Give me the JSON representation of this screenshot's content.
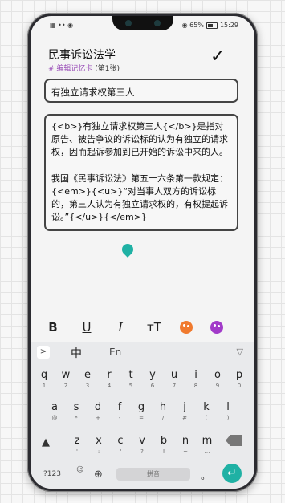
{
  "status": {
    "left": "▦ •• ◉",
    "battery_text": "◉ 65%",
    "time": "15:29"
  },
  "header": {
    "title": "民事诉讼法学",
    "subtitle_edit": "# 编辑记忆卡",
    "subtitle_count": " (第1张)",
    "confirm_glyph": "✓"
  },
  "card": {
    "front": "有独立请求权第三人",
    "back_para1": "{<b>}有独立请求权第三人{</b>}是指对原告、被告争议的诉讼标的认为有独立的请求权，因而起诉参加到已开始的诉讼中来的人。",
    "back_para2": "我国《民事诉讼法》第五十六条第一款规定：{<em>}{<u>}“对当事人双方的诉讼标的，第三人认为有独立请求权的，有权提起诉讼。”{</u>}{</em>}"
  },
  "format_bar": {
    "bold": "B",
    "underline": "U",
    "italic": "I",
    "text_size": "тT",
    "palette1_color": "#f07a2e",
    "palette2_color": "#a23bc9"
  },
  "keyboard": {
    "toolbar_arrow": ">",
    "mode_chinese": "中",
    "mode_english": "En",
    "collapse": "▽",
    "row1": [
      {
        "k": "q",
        "s": "1"
      },
      {
        "k": "w",
        "s": "2"
      },
      {
        "k": "e",
        "s": "3"
      },
      {
        "k": "r",
        "s": "4"
      },
      {
        "k": "t",
        "s": "5"
      },
      {
        "k": "y",
        "s": "6"
      },
      {
        "k": "u",
        "s": "7"
      },
      {
        "k": "i",
        "s": "8"
      },
      {
        "k": "o",
        "s": "9"
      },
      {
        "k": "p",
        "s": "0"
      }
    ],
    "row2": [
      {
        "k": "a",
        "s": "@"
      },
      {
        "k": "s",
        "s": "*"
      },
      {
        "k": "d",
        "s": "+"
      },
      {
        "k": "f",
        "s": "-"
      },
      {
        "k": "g",
        "s": "="
      },
      {
        "k": "h",
        "s": "/"
      },
      {
        "k": "j",
        "s": "#"
      },
      {
        "k": "k",
        "s": "("
      },
      {
        "k": "l",
        "s": ")"
      }
    ],
    "row3": [
      {
        "k": "z",
        "s": "'"
      },
      {
        "k": "x",
        "s": ":"
      },
      {
        "k": "c",
        "s": "\""
      },
      {
        "k": "v",
        "s": "?"
      },
      {
        "k": "b",
        "s": "!"
      },
      {
        "k": "n",
        "s": "~"
      },
      {
        "k": "m",
        "s": "…"
      }
    ],
    "num_key": "?123",
    "emoji_key": "☺",
    "space_label": "拼音",
    "period_key": "。",
    "enter_glyph": "↵"
  }
}
